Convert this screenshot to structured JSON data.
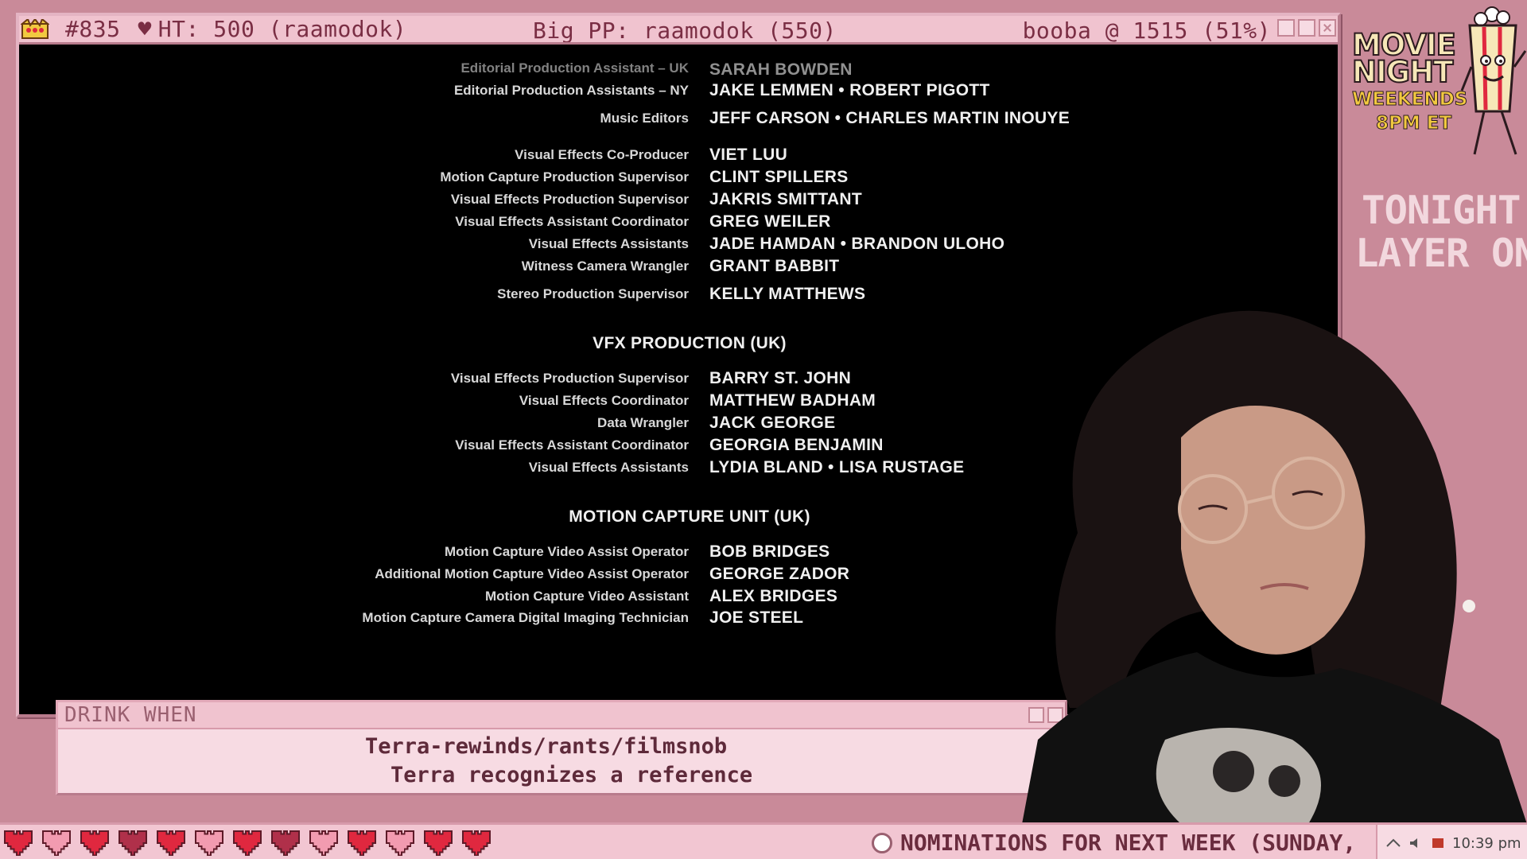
{
  "titlebar": {
    "rank": "#835",
    "heart": "♥",
    "ht": "HT: 500 (raamodok)",
    "big_pp": "Big PP: raamodok (550)",
    "booba": "booba @ 1515 (51%)"
  },
  "credits": {
    "top_cut": {
      "role": "Editorial Production Assistant – UK",
      "name": "SARAH BOWDEN"
    },
    "group1": [
      {
        "role": "Editorial Production Assistants – NY",
        "name": "JAKE LEMMEN • ROBERT PIGOTT"
      },
      {
        "role": "Music Editors",
        "name": "JEFF CARSON • CHARLES MARTIN INOUYE"
      }
    ],
    "group2": [
      {
        "role": "Visual Effects Co-Producer",
        "name": "VIET LUU"
      },
      {
        "role": "Motion Capture Production Supervisor",
        "name": "CLINT SPILLERS"
      },
      {
        "role": "Visual Effects Production Supervisor",
        "name": "JAKRIS SMITTANT"
      },
      {
        "role": "Visual Effects Assistant Coordinator",
        "name": "GREG WEILER"
      },
      {
        "role": "Visual Effects Assistants",
        "name": "JADE HAMDAN • BRANDON ULOHO"
      },
      {
        "role": "Witness Camera Wrangler",
        "name": "GRANT BABBIT"
      },
      {
        "role": "Stereo Production Supervisor",
        "name": "KELLY MATTHEWS"
      }
    ],
    "section_vfx": "VFX PRODUCTION (UK)",
    "group3": [
      {
        "role": "Visual Effects Production Supervisor",
        "name": "BARRY ST. JOHN"
      },
      {
        "role": "Visual Effects Coordinator",
        "name": "MATTHEW BADHAM"
      },
      {
        "role": "Data Wrangler",
        "name": "JACK GEORGE"
      },
      {
        "role": "Visual Effects Assistant Coordinator",
        "name": "GEORGIA BENJAMIN"
      },
      {
        "role": "Visual Effects Assistants",
        "name": "LYDIA BLAND • LISA RUSTAGE"
      }
    ],
    "section_mocap": "MOTION CAPTURE UNIT (UK)",
    "group4": [
      {
        "role": "Motion Capture Video Assist Operator",
        "name": "BOB BRIDGES"
      },
      {
        "role": "Additional Motion Capture Video Assist Operator",
        "name": "GEORGE ZADOR"
      },
      {
        "role": "Motion Capture Video Assistant",
        "name": "ALEX BRIDGES"
      },
      {
        "role": "Motion Capture Camera Digital Imaging Technician",
        "name": "JOE STEEL"
      }
    ]
  },
  "drink_when": {
    "title": "DRINK WHEN",
    "line1": "Terra-rewinds/rants/filmsnob",
    "line2": "Terra recognizes a reference"
  },
  "movie_night": {
    "title_line1": "MOVIE",
    "title_line2": "NIGHT",
    "sub_line1": "WEEKENDS",
    "sub_line2": "8PM ET"
  },
  "tonight": {
    "line1": "TONIGHT:",
    "line2": "LAYER ONE"
  },
  "ticker": {
    "text": "NOMINATIONS FOR NEXT WEEK (SUNDAY,"
  },
  "tray": {
    "time": "10:39 pm"
  },
  "colors": {
    "background": "#c98a99",
    "window_frame": "#f0c3cf",
    "title_text": "#7a2e44",
    "heart_red": "#e0283f",
    "heart_pink": "#f29bb0",
    "heart_dark": "#b0304a"
  },
  "hearts": [
    "heart-red-icon",
    "heart-pink-icon",
    "heart-red-icon",
    "heart-dark-icon",
    "heart-red-icon",
    "heart-pink-icon",
    "heart-red-icon",
    "heart-dark-icon",
    "heart-pink-icon",
    "heart-red-icon",
    "heart-pink-icon",
    "heart-red-icon",
    "heart-red-icon"
  ]
}
